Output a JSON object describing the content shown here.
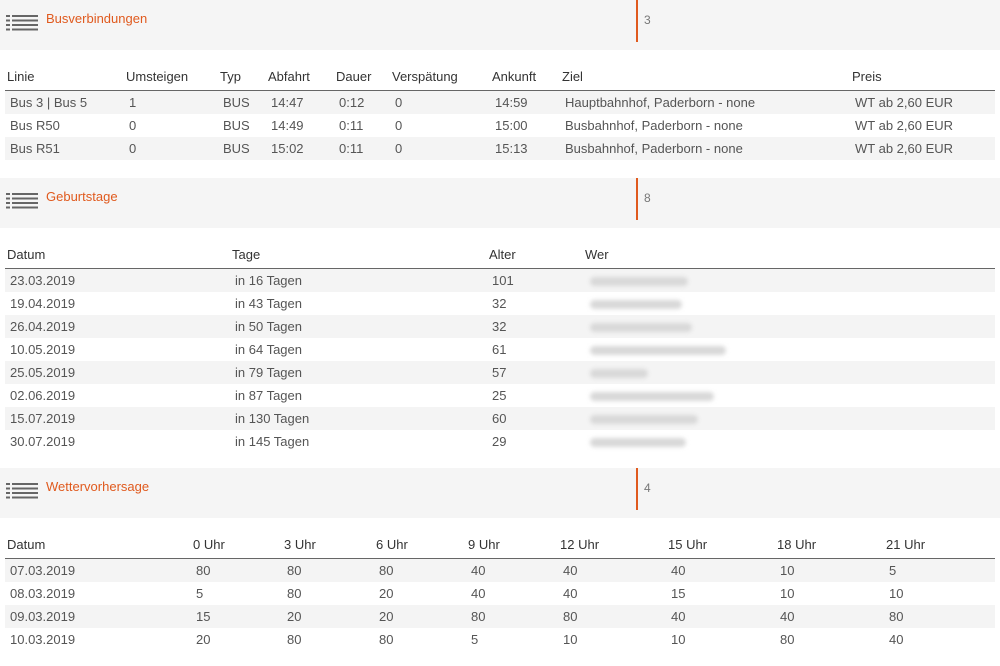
{
  "bus": {
    "title": "Busverbindungen",
    "count": "3",
    "columns": [
      "Linie",
      "Umsteigen",
      "Typ",
      "Abfahrt",
      "Dauer",
      "Verspätung",
      "Ankunft",
      "Ziel",
      "Preis"
    ],
    "rows": [
      [
        "Bus 3 | Bus 5",
        "1",
        "BUS",
        "14:47",
        "0:12",
        "0",
        "14:59",
        "Hauptbahnhof, Paderborn - none",
        "WT ab 2,60 EUR"
      ],
      [
        "Bus R50",
        "0",
        "BUS",
        "14:49",
        "0:11",
        "0",
        "15:00",
        "Busbahnhof, Paderborn - none",
        "WT ab 2,60 EUR"
      ],
      [
        "Bus R51",
        "0",
        "BUS",
        "15:02",
        "0:11",
        "0",
        "15:13",
        "Busbahnhof, Paderborn - none",
        "WT ab 2,60 EUR"
      ]
    ]
  },
  "birthdays": {
    "title": "Geburtstage",
    "count": "8",
    "columns": [
      "Datum",
      "Tage",
      "Alter",
      "Wer"
    ],
    "rows": [
      [
        "23.03.2019",
        "in 16 Tagen",
        "101"
      ],
      [
        "19.04.2019",
        "in 43 Tagen",
        "32"
      ],
      [
        "26.04.2019",
        "in 50 Tagen",
        "32"
      ],
      [
        "10.05.2019",
        "in 64 Tagen",
        "61"
      ],
      [
        "25.05.2019",
        "in 79 Tagen",
        "57"
      ],
      [
        "02.06.2019",
        "in 87 Tagen",
        "25"
      ],
      [
        "15.07.2019",
        "in 130 Tagen",
        "60"
      ],
      [
        "30.07.2019",
        "in 145 Tagen",
        "29"
      ]
    ]
  },
  "weather": {
    "title": "Wettervorhersage",
    "count": "4",
    "columns": [
      "Datum",
      "0 Uhr",
      "3 Uhr",
      "6 Uhr",
      "9 Uhr",
      "12 Uhr",
      "15 Uhr",
      "18 Uhr",
      "21 Uhr"
    ],
    "rows": [
      [
        "07.03.2019",
        "80",
        "80",
        "80",
        "40",
        "40",
        "40",
        "10",
        "5"
      ],
      [
        "08.03.2019",
        "5",
        "80",
        "20",
        "40",
        "40",
        "15",
        "10",
        "10"
      ],
      [
        "09.03.2019",
        "15",
        "20",
        "20",
        "80",
        "80",
        "40",
        "40",
        "80"
      ],
      [
        "10.03.2019",
        "20",
        "80",
        "80",
        "5",
        "10",
        "10",
        "80",
        "40"
      ]
    ]
  },
  "colors": {
    "accent": "#e05a1e",
    "header_bg": "#f5f5f5",
    "row_alt": "#f4f4f4"
  },
  "icons": {
    "section": "list-icon"
  }
}
